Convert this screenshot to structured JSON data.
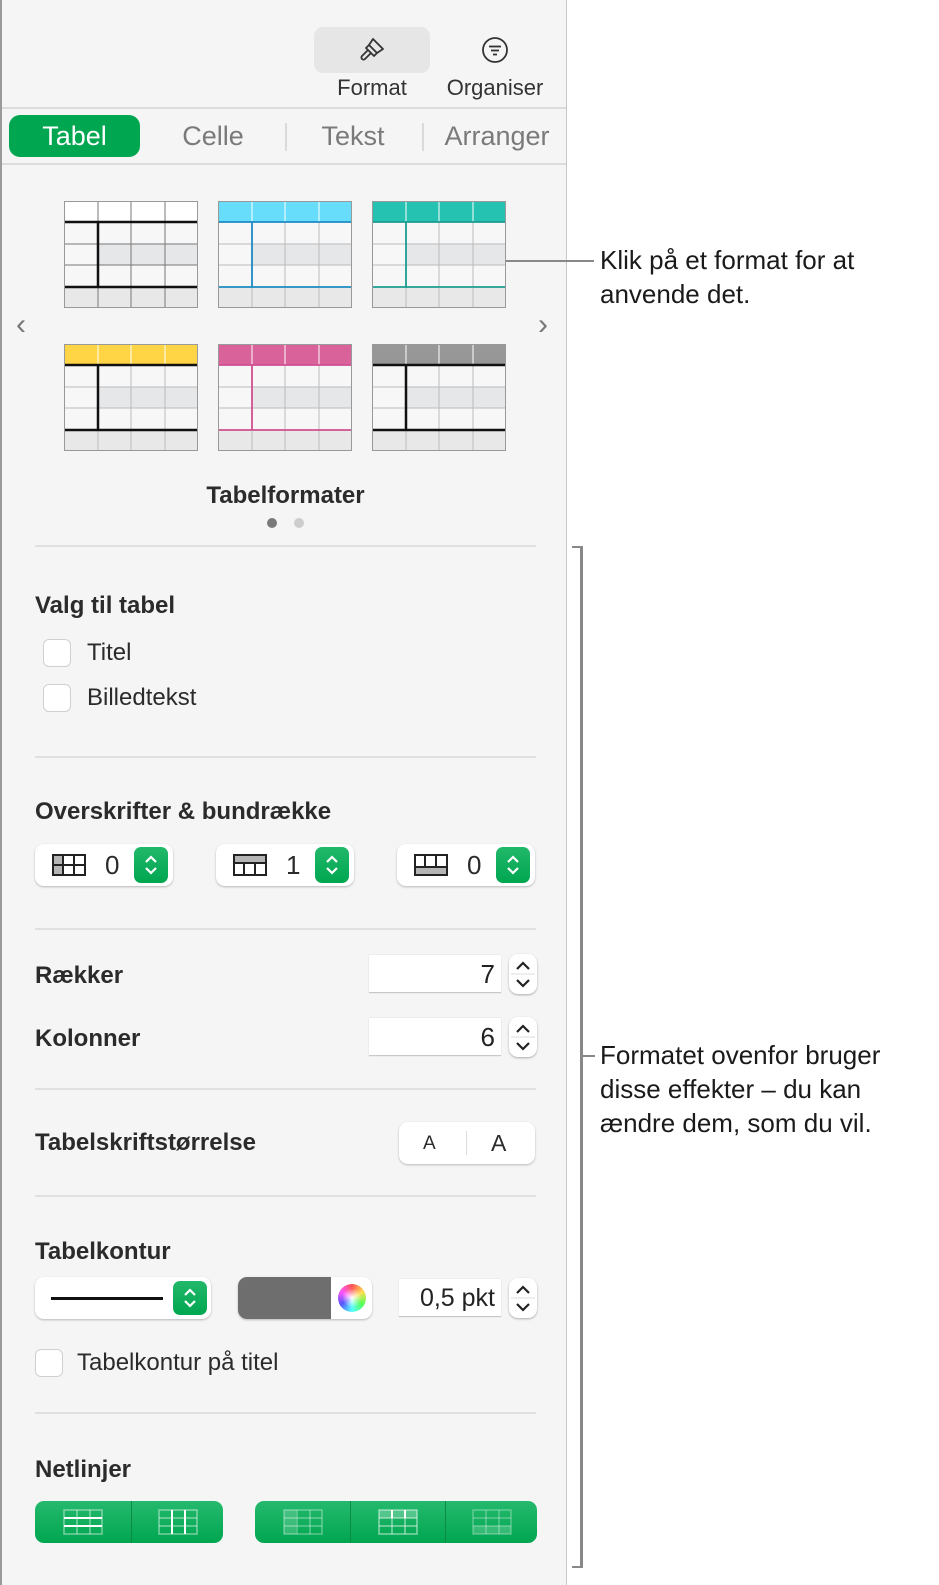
{
  "toolbar": {
    "format_label": "Format",
    "organise_label": "Organiser"
  },
  "tabs": [
    {
      "label": "Tabel",
      "active": true
    },
    {
      "label": "Celle",
      "active": false
    },
    {
      "label": "Tekst",
      "active": false
    },
    {
      "label": "Arranger",
      "active": false
    }
  ],
  "table_styles": {
    "title": "Tabelformater",
    "page_count": 2,
    "current_page": 1,
    "styles": [
      {
        "name": "plain-black",
        "header_color": "#ffffff",
        "line_color": "#111111"
      },
      {
        "name": "cyan",
        "header_color": "#67dcfb",
        "line_color": "#1d8ac2"
      },
      {
        "name": "teal",
        "header_color": "#25c1b1",
        "line_color": "#1a9c90"
      },
      {
        "name": "yellow",
        "header_color": "#ffd445",
        "line_color": "#111111"
      },
      {
        "name": "pink",
        "header_color": "#d9629a",
        "line_color": "#d04f90"
      },
      {
        "name": "gray",
        "header_color": "#979797",
        "line_color": "#111111"
      }
    ]
  },
  "table_options": {
    "title": "Valg til tabel",
    "checkboxes": [
      {
        "label": "Titel",
        "checked": false
      },
      {
        "label": "Billedtekst",
        "checked": false
      }
    ]
  },
  "headers_footer": {
    "title": "Overskrifter & bundrække",
    "header_columns": "0",
    "header_rows": "1",
    "footer_rows": "0"
  },
  "rows_cols": {
    "rows_label": "Rækker",
    "rows_value": "7",
    "cols_label": "Kolonner",
    "cols_value": "6"
  },
  "font_size": {
    "label": "Tabelskriftstørrelse",
    "smaller": "A",
    "larger": "A"
  },
  "outline": {
    "title": "Tabelkontur",
    "color": "#6e6e6e",
    "width_value": "0,5 pkt",
    "title_outline_label": "Tabelkontur på titel",
    "title_outline_checked": false
  },
  "gridlines": {
    "title": "Netlinjer"
  },
  "callouts": {
    "top": "Klik på et format for at anvende det.",
    "bottom": "Formatet ovenfor bruger disse effekter – du kan ændre dem, som du vil."
  }
}
